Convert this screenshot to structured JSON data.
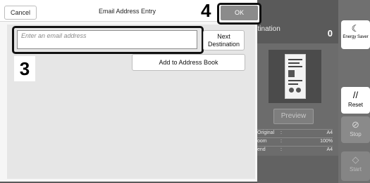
{
  "dialog": {
    "title": "Email Address Entry",
    "cancel_label": "Cancel",
    "ok_label": "OK",
    "email_placeholder": "Enter an email address",
    "email_value": "",
    "next_destination_line1": "Next",
    "next_destination_line2": "Destination",
    "add_to_address_book_label": "Add to Address Book"
  },
  "callouts": {
    "step_ok": "4",
    "step_email": "3"
  },
  "background": {
    "destination_label": "estination",
    "destination_count": "0",
    "preview_label": "Preview",
    "info_rows": [
      {
        "key": "Original",
        "value": "A4"
      },
      {
        "key": "oom",
        "value": "100%"
      },
      {
        "key": "end",
        "value": "A4"
      }
    ]
  },
  "sidebar": {
    "energy_saver_label": "Energy Saver",
    "energy_icon": "moon-icon",
    "reset_label": "Reset",
    "reset_icon": "reset-icon",
    "stop_label": "Stop",
    "stop_icon": "stop-icon",
    "start_label": "Start",
    "start_icon": "start-icon"
  },
  "colors": {
    "highlight_border": "#111111",
    "ok_button_bg": "#8b8b8b",
    "screen_bg": "#5a5a5a"
  }
}
